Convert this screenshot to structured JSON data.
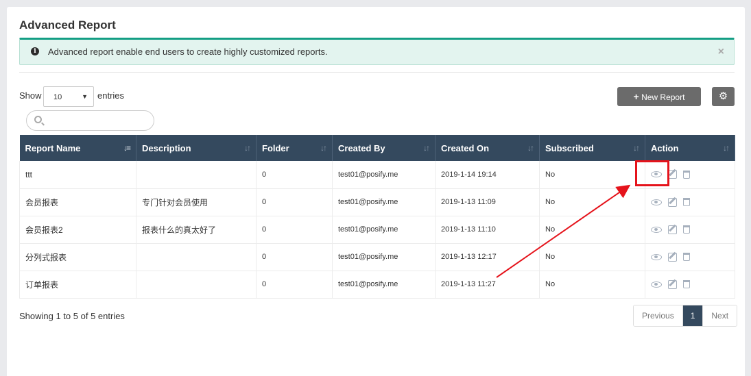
{
  "title": "Advanced Report",
  "alert": {
    "icon": "info-circle-icon",
    "message": "Advanced report enable end users to create highly customized reports.",
    "close": "×"
  },
  "controls": {
    "show_label": "Show",
    "entries_value": "10",
    "entries_label": "entries",
    "search_placeholder": "",
    "new_report_label": "New Report",
    "new_report_plus": "+",
    "settings_icon": "gear-icon"
  },
  "table": {
    "columns": [
      "Report Name",
      "Description",
      "Folder",
      "Created By",
      "Created On",
      "Subscribed",
      "Action"
    ],
    "rows": [
      {
        "name": "ttt",
        "description": "",
        "folder": "0",
        "created_by": "test01@posify.me",
        "created_on": "2019-1-14 19:14",
        "subscribed": "No"
      },
      {
        "name": "会员报表",
        "description": "专门针对会员使用",
        "folder": "0",
        "created_by": "test01@posify.me",
        "created_on": "2019-1-13 11:09",
        "subscribed": "No"
      },
      {
        "name": "会员报表2",
        "description": "报表什么的真太好了",
        "folder": "0",
        "created_by": "test01@posify.me",
        "created_on": "2019-1-13 11:10",
        "subscribed": "No"
      },
      {
        "name": "分列式报表",
        "description": "",
        "folder": "0",
        "created_by": "test01@posify.me",
        "created_on": "2019-1-13 12:17",
        "subscribed": "No"
      },
      {
        "name": "订单报表",
        "description": "",
        "folder": "0",
        "created_by": "test01@posify.me",
        "created_on": "2019-1-13 11:27",
        "subscribed": "No"
      }
    ]
  },
  "footer": {
    "info": "Showing 1 to 5 of 5 entries",
    "prev": "Previous",
    "page": "1",
    "next": "Next"
  },
  "colors": {
    "header_bg": "#34495e",
    "alert_accent": "#149e84",
    "annotation": "#e5131b"
  }
}
